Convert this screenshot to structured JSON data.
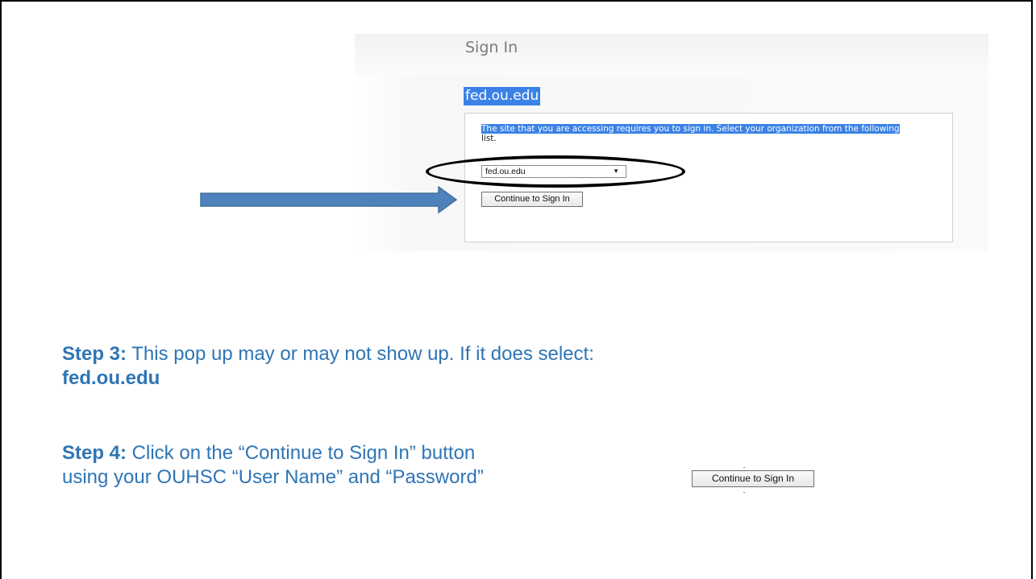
{
  "signin": {
    "title": "Sign In",
    "org_heading": "fed.ou.edu",
    "message_line1": "The site that you are accessing requires you to sign in. Select your organization from the following",
    "message_line2": "list.",
    "select_value": "fed.ou.edu",
    "select_caret": "▼",
    "continue_button": "Continue to Sign In"
  },
  "instructions": {
    "step3_label": "Step 3:",
    "step3_text": " This pop up may or may not show up. If it does select:",
    "step3_value": "fed.ou.edu",
    "step4_label": "Step 4:",
    "step4_text_line1": "  Click on the “Continue to Sign In” button",
    "step4_text_line2": "using your OUHSC “User Name” and  “Password”",
    "side_button": "Continue to Sign In"
  },
  "colors": {
    "accent": "#2e75b6",
    "highlight": "#3b82e6",
    "arrow": "#4f81bd"
  }
}
